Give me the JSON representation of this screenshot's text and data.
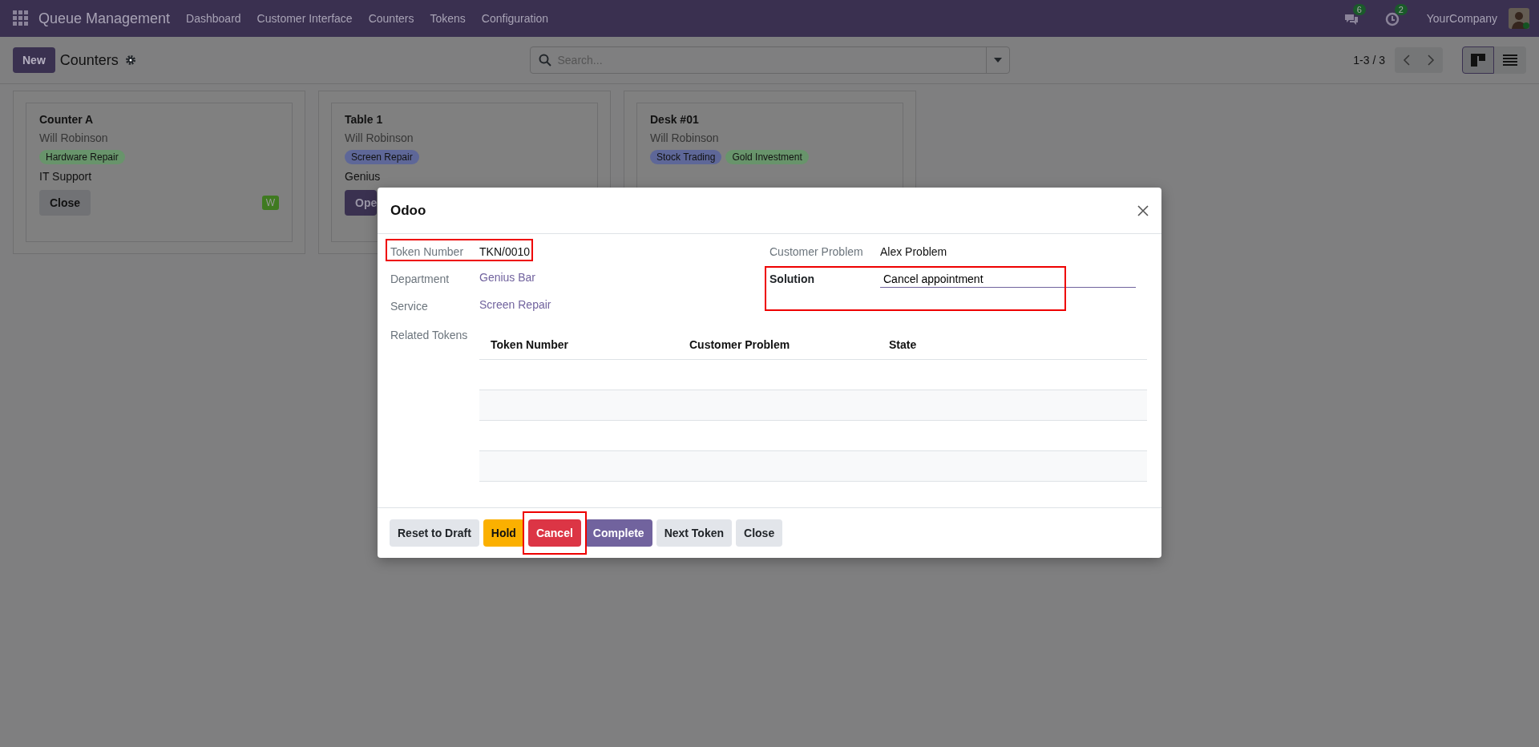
{
  "navbar": {
    "app_title": "Queue Management",
    "menu": [
      "Dashboard",
      "Customer Interface",
      "Counters",
      "Tokens",
      "Configuration"
    ],
    "messages_count": "6",
    "activities_count": "2",
    "company": "YourCompany"
  },
  "control_panel": {
    "new_button": "New",
    "title": "Counters",
    "search": {
      "placeholder": "Search..."
    },
    "pager": "1-3 / 3",
    "views": [
      {
        "kind": "kanban",
        "selected": true
      },
      {
        "kind": "list",
        "selected": false
      }
    ]
  },
  "counters": [
    {
      "name": "Counter A",
      "user": "Will Robinson",
      "tags": [
        {
          "label": "Hardware Repair",
          "color": "#68946b"
        }
      ],
      "department": "IT Support",
      "button": {
        "label": "Close",
        "kind": "secondary"
      },
      "badge": "W"
    },
    {
      "name": "Table 1",
      "user": "Will Robinson",
      "tags": [
        {
          "label": "Screen Repair",
          "color": "#5e6798"
        }
      ],
      "department": "Genius",
      "button": {
        "label": "Ope",
        "kind": "primary"
      }
    },
    {
      "name": "Desk #01",
      "user": "Will Robinson",
      "tags": [
        {
          "label": "Stock Trading",
          "color": "#5e6798"
        },
        {
          "label": "Gold Investment",
          "color": "#68946b"
        }
      ]
    }
  ],
  "dialog": {
    "title": "Odoo",
    "left_fields": [
      {
        "label": "Token Number",
        "value": "TKN/0010",
        "kind": "text",
        "highlighted": true
      },
      {
        "label": "Department",
        "value": "Genius Bar",
        "kind": "link",
        "highlighted": false
      },
      {
        "label": "Service",
        "value": "Screen Repair",
        "kind": "link",
        "highlighted": false
      }
    ],
    "right_fields": [
      {
        "label": "Customer Problem",
        "value": "Alex Problem",
        "kind": "text",
        "highlighted": false
      },
      {
        "label": "Solution",
        "value": "Cancel appointment",
        "kind": "input",
        "highlighted": true
      }
    ],
    "related_tokens": {
      "label": "Related Tokens",
      "columns": [
        "Token Number",
        "Customer Problem",
        "State"
      ]
    },
    "buttons": [
      {
        "label": "Reset to Draft",
        "kind": "secondary",
        "highlighted": false
      },
      {
        "label": "Hold",
        "kind": "warning",
        "highlighted": false
      },
      {
        "label": "Cancel",
        "kind": "danger",
        "highlighted": true
      },
      {
        "label": "Complete",
        "kind": "primary",
        "highlighted": false
      },
      {
        "label": "Next Token",
        "kind": "secondary",
        "highlighted": false
      },
      {
        "label": "Close",
        "kind": "secondary",
        "highlighted": false
      }
    ]
  }
}
